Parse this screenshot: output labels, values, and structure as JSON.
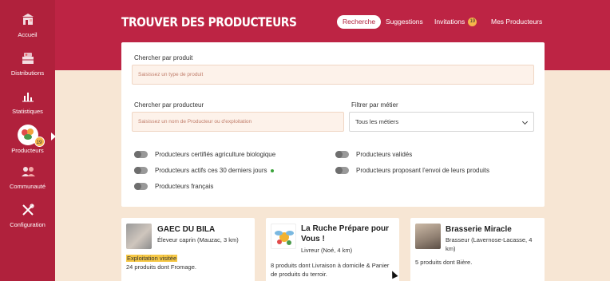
{
  "sidebar": {
    "items": [
      {
        "label": "Accueil",
        "icon": "shop-icon"
      },
      {
        "label": "Distributions",
        "icon": "crate-icon"
      },
      {
        "label": "Statistiques",
        "icon": "bar-chart-icon"
      },
      {
        "label": "Producteurs",
        "icon": "producers-avatar",
        "badge": "19"
      },
      {
        "label": "Communauté",
        "icon": "community-icon"
      },
      {
        "label": "Configuration",
        "icon": "tools-icon"
      }
    ]
  },
  "header": {
    "title": "TROUVER DES PRODUCTEURS",
    "tabs": [
      {
        "label": "Recherche",
        "active": true
      },
      {
        "label": "Suggestions"
      },
      {
        "label": "Invitations",
        "badge": "19"
      },
      {
        "label": "Mes Producteurs"
      }
    ]
  },
  "search": {
    "product_label": "Chercher par produit",
    "product_placeholder": "Saisissez un type de produit",
    "producer_label": "Chercher par producteur",
    "producer_placeholder": "Saisissez un nom de Producteur ou d'exploitation",
    "job_label": "Filtrer par métier",
    "job_value": "Tous les métiers",
    "filters": [
      "Producteurs certifiés agriculture biologique",
      "Producteurs actifs ces 30 derniers jours",
      "Producteurs français",
      "Producteurs validés",
      "Producteurs proposant l'envoi de leurs produits"
    ]
  },
  "producers": [
    {
      "name": "GAEC DU BILA",
      "subtitle": "Éleveur caprin (Mauzac, 3 km)",
      "visited": "Exploitation visitée",
      "description": "24 produits dont Fromage."
    },
    {
      "name": "La Ruche Prépare pour Vous !",
      "subtitle": "Livreur (Noé, 4 km)",
      "description": "8 produits dont Livraison à domicile & Panier de produits du terroir."
    },
    {
      "name": "Brasserie Miracle",
      "subtitle": "Brasseur (Lavernose-Lacasse, 4 km)",
      "description": "5 produits dont Bière."
    }
  ],
  "colors": {
    "sidebar": "#b0213c",
    "header": "#bd2444",
    "background": "#f7e6d4",
    "badge": "#f6b64a",
    "active_green": "#3aa33a"
  }
}
